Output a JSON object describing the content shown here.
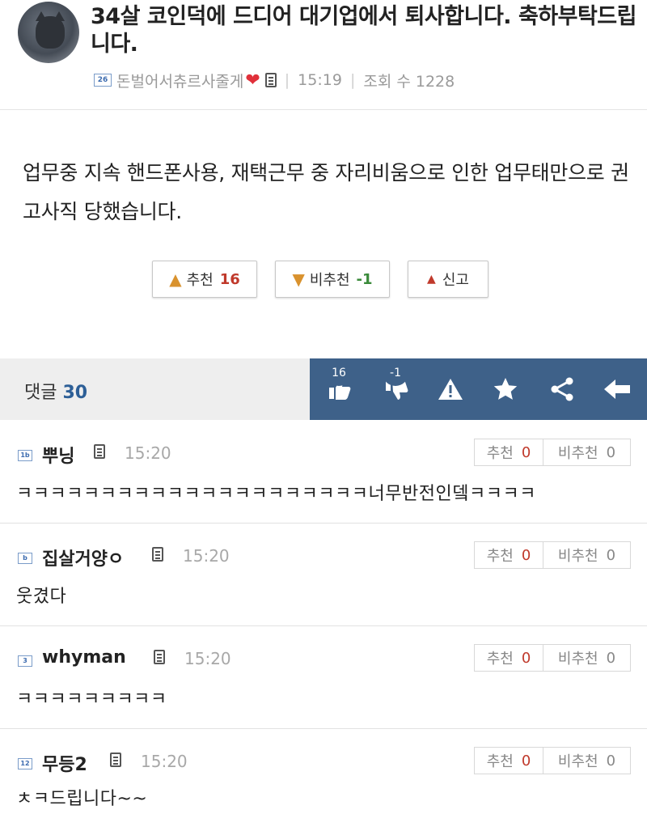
{
  "post": {
    "title": "34살 코인덕에 드디어 대기업에서 퇴사합니다. 축하부탁드립니다.",
    "author_level": "26",
    "author": "돈벌어서츄르사줄게",
    "time": "15:19",
    "views_label": "조회 수 1228",
    "body": "업무중 지속 핸드폰사용, 재택근무 중 자리비움으로 인한 업무태만으로 권고사직 당했습니다."
  },
  "votes": {
    "up_label": "추천",
    "up_count": "16",
    "down_label": "비추천",
    "down_count": "-1",
    "report_label": "신고"
  },
  "comment_bar": {
    "label": "댓글",
    "count": "30",
    "like_badge": "16",
    "dislike_badge": "-1"
  },
  "comments": [
    {
      "level": "1b",
      "name": "뿌닝",
      "time": "15:20",
      "up_label": "추천",
      "up": "0",
      "down_label": "비추천",
      "down": "0",
      "text": "ㅋㅋㅋㅋㅋㅋㅋㅋㅋㅋㅋㅋㅋㅋㅋㅋㅋㅋㅋㅋㅋ너무반전인뎈ㅋㅋㅋㅋ"
    },
    {
      "level": "b",
      "name": "집살거양ㅇ",
      "time": "15:20",
      "up_label": "추천",
      "up": "0",
      "down_label": "비추천",
      "down": "0",
      "text": "웃겼다"
    },
    {
      "level": "3",
      "name": "whyman",
      "time": "15:20",
      "up_label": "추천",
      "up": "0",
      "down_label": "비추천",
      "down": "0",
      "text": "ㅋㅋㅋㅋㅋㅋㅋㅋㅋ"
    },
    {
      "level": "12",
      "name": "무등2",
      "time": "15:20",
      "up_label": "추천",
      "up": "0",
      "down_label": "비추천",
      "down": "0",
      "text": "ㅊㅋ드립니다~~"
    }
  ],
  "colors": {
    "accent_bar": "#3e6189",
    "up_count": "#c0392b",
    "down_count": "#3a8a3a",
    "heart": "#e0303a"
  },
  "icons": [
    "thumbs-up-icon",
    "thumbs-down-icon",
    "warning-icon",
    "star-icon",
    "share-icon",
    "back-arrow-icon",
    "memo-icon",
    "heart-icon",
    "siren-icon"
  ]
}
